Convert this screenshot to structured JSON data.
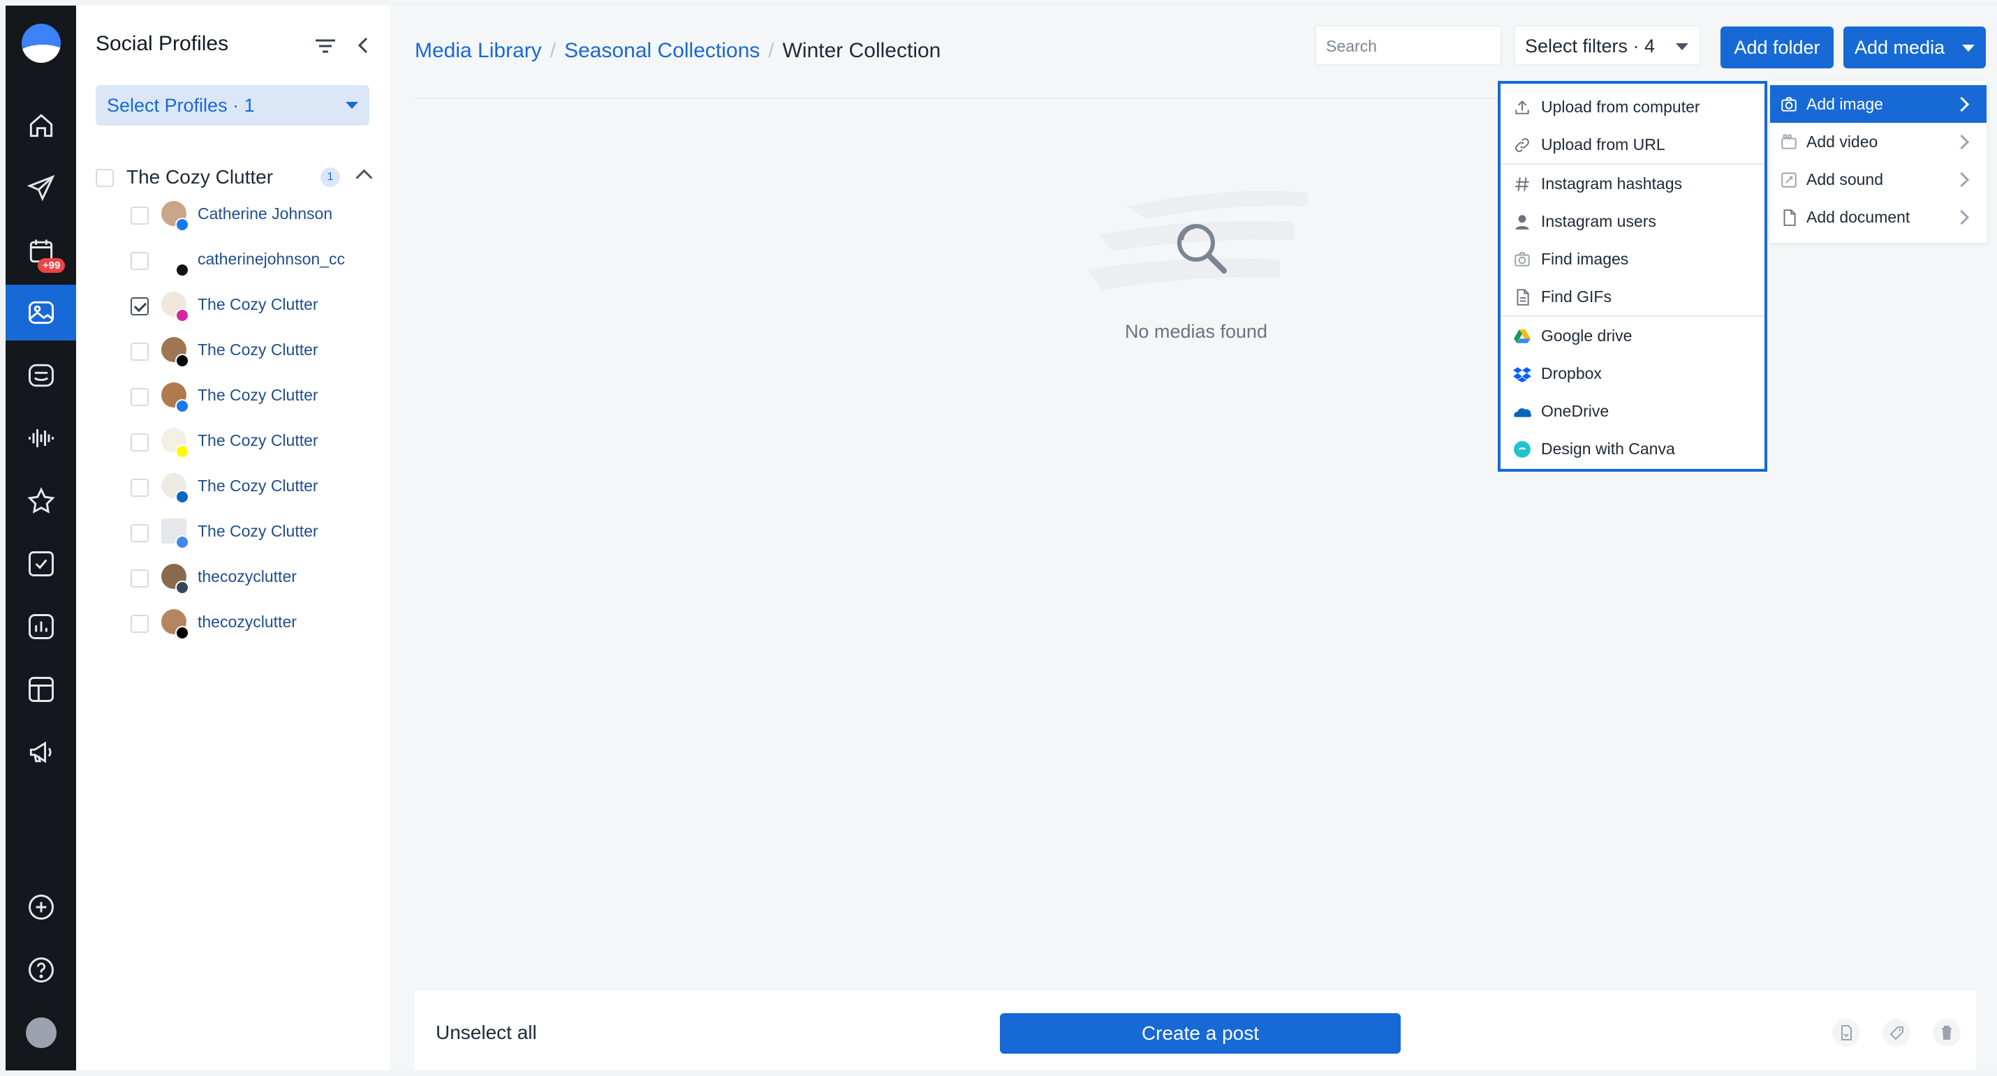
{
  "rail": {
    "notification_badge": "+99",
    "items": [
      "home-icon",
      "send-icon",
      "calendar-icon",
      "media-library-icon",
      "inbox-icon",
      "listening-icon",
      "star-icon",
      "tasks-icon",
      "analytics-icon",
      "layout-icon",
      "megaphone-icon"
    ],
    "bottom_items": [
      "add-icon",
      "help-icon",
      "avatar"
    ]
  },
  "profiles_panel": {
    "title": "Social Profiles",
    "select_label": "Select Profiles · 1",
    "group": {
      "name": "The Cozy Clutter",
      "count": "1"
    },
    "profiles": [
      {
        "name": "Catherine Johnson",
        "network": "facebook",
        "checked": false
      },
      {
        "name": "catherinejohnson_cc",
        "network": "threads",
        "checked": false
      },
      {
        "name": "The Cozy Clutter",
        "network": "instagram",
        "checked": true
      },
      {
        "name": "The Cozy Clutter",
        "network": "x",
        "checked": false
      },
      {
        "name": "The Cozy Clutter",
        "network": "facebook",
        "checked": false
      },
      {
        "name": "The Cozy Clutter",
        "network": "snapchat",
        "checked": false
      },
      {
        "name": "The Cozy Clutter",
        "network": "linkedin",
        "checked": false
      },
      {
        "name": "The Cozy Clutter",
        "network": "google-business",
        "checked": false
      },
      {
        "name": "thecozyclutter",
        "network": "tumblr",
        "checked": false
      },
      {
        "name": "thecozyclutter",
        "network": "tiktok",
        "checked": false
      }
    ]
  },
  "breadcrumb": {
    "items": [
      "Media Library",
      "Seasonal Collections",
      "Winter Collection"
    ]
  },
  "toolbar": {
    "search_placeholder": "Search",
    "filters_label": "Select filters · 4",
    "add_folder": "Add folder",
    "add_media": "Add media"
  },
  "empty_state": {
    "text": "No medias found"
  },
  "source_menu": {
    "items": [
      {
        "label": "Upload from computer",
        "icon": "upload-icon"
      },
      {
        "label": "Upload from URL",
        "icon": "link-icon"
      },
      {
        "label": "Instagram hashtags",
        "icon": "hashtag-icon"
      },
      {
        "label": "Instagram users",
        "icon": "user-icon"
      },
      {
        "label": "Find images",
        "icon": "camera-icon"
      },
      {
        "label": "Find GIFs",
        "icon": "gif-file-icon"
      },
      {
        "label": "Google drive",
        "icon": "google-drive-icon"
      },
      {
        "label": "Dropbox",
        "icon": "dropbox-icon"
      },
      {
        "label": "OneDrive",
        "icon": "onedrive-icon"
      },
      {
        "label": "Design with Canva",
        "icon": "canva-icon"
      }
    ]
  },
  "type_menu": {
    "items": [
      {
        "label": "Add image",
        "icon": "camera-icon",
        "active": true
      },
      {
        "label": "Add video",
        "icon": "video-icon",
        "active": false
      },
      {
        "label": "Add sound",
        "icon": "sound-icon",
        "active": false
      },
      {
        "label": "Add document",
        "icon": "document-icon",
        "active": false
      }
    ]
  },
  "bottom_bar": {
    "unselect_all": "Unselect all",
    "create_post": "Create a post",
    "icons": [
      "convert-icon",
      "tag-icon",
      "trash-icon"
    ]
  },
  "colors": {
    "accent": "#1769d6",
    "rail_bg": "#14171c",
    "badge": "#ef4444"
  }
}
